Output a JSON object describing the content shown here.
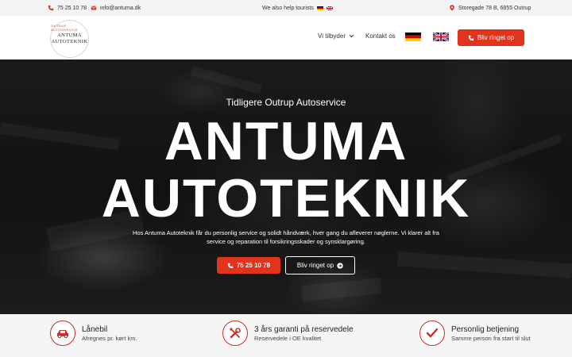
{
  "topbar": {
    "phone": "75 25 10 78",
    "email": "info@antuma.dk",
    "tourists": "We also help tourists",
    "address": "Storegade 78 B, 6855 Outrup"
  },
  "logo": {
    "arc_top": "OUTRUP AUTOSERVICE",
    "line1": "ANTUMA",
    "line2": "AUTOTEKNIK"
  },
  "nav": {
    "services": "Vi tilbyder",
    "contact": "Kontakt os",
    "cta": "Bliv ringet op"
  },
  "hero": {
    "subtitle": "Tidligere Outrup Autoservice",
    "title_line1": "ANTUMA",
    "title_line2": "AUTOTEKNIK",
    "description": "Hos Antuma Autoteknik får du personlig service og solidt håndværk, hver gang du afleverer nøglerne. Vi klarer alt fra service og reparation til forsikringsskader og synsklargøring.",
    "phone_button": "75 25 10 78",
    "call_button": "Bliv ringet op"
  },
  "features": [
    {
      "title": "Lånebil",
      "subtitle": "Afregnes pr. kørt km.",
      "icon": "car-icon"
    },
    {
      "title": "3 års garanti på reservedele",
      "subtitle": "Reservedele i OE kvalitet",
      "icon": "tools-icon"
    },
    {
      "title": "Personlig betjening",
      "subtitle": "Samme person fra start til slut",
      "icon": "check-icon"
    }
  ],
  "colors": {
    "accent": "#e2341d",
    "icon_ring": "#c9302c"
  }
}
